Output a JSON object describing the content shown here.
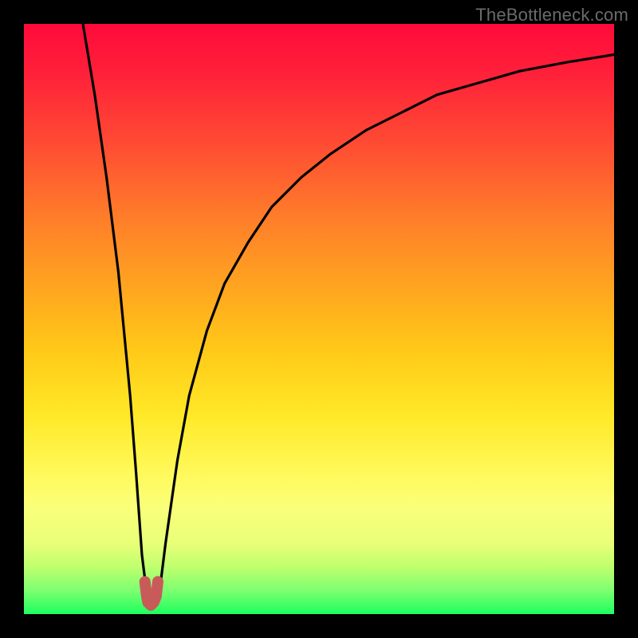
{
  "watermark": "TheBottleneck.com",
  "chart_data": {
    "type": "line",
    "title": "",
    "xlabel": "",
    "ylabel": "",
    "xlim": [
      0,
      100
    ],
    "ylim": [
      0,
      100
    ],
    "grid": false,
    "series": [
      {
        "name": "bottleneck-curve",
        "x": [
          10,
          12,
          14,
          16,
          18,
          19,
          20,
          21,
          22,
          23,
          24,
          26,
          28,
          31,
          34,
          38,
          42,
          47,
          52,
          58,
          64,
          70,
          77,
          84,
          92,
          100
        ],
        "values": [
          100,
          88,
          74,
          58,
          37,
          24,
          10,
          2,
          1,
          4,
          12,
          26,
          37,
          48,
          56,
          63,
          69,
          74,
          78,
          82,
          85,
          88,
          90,
          92,
          93.5,
          94.8
        ]
      },
      {
        "name": "optimal-marker",
        "x": [
          20.5,
          20.8,
          21.0,
          21.5,
          22.0,
          22.4,
          22.7
        ],
        "values": [
          5.5,
          3.0,
          2.0,
          1.5,
          2.0,
          3.0,
          5.5
        ]
      }
    ],
    "annotations": []
  },
  "colors": {
    "curve": "#000000",
    "marker": "#c95a5a",
    "frame": "#000000"
  }
}
